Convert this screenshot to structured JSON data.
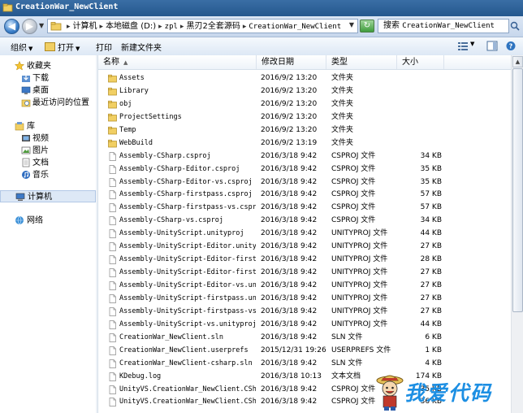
{
  "window": {
    "title": "CreationWar_NewClient"
  },
  "address": {
    "crumbs": [
      {
        "label": "计算机",
        "mono": false
      },
      {
        "label": "本地磁盘 (D:)",
        "mono": false
      },
      {
        "label": "zpl",
        "mono": true
      },
      {
        "label": "黑刃2全套源码",
        "mono": false
      },
      {
        "label": "CreationWar_NewClient",
        "mono": true
      }
    ]
  },
  "search": {
    "prefix": "搜索",
    "target": "CreationWar_NewClient"
  },
  "toolbar": {
    "organize": "组织",
    "open": "打开",
    "print": "打印",
    "new_folder": "新建文件夹"
  },
  "sidebar": {
    "favorites": "收藏夹",
    "fav_items": [
      "下载",
      "桌面",
      "最近访问的位置"
    ],
    "library": "库",
    "lib_items": [
      "视频",
      "图片",
      "文档",
      "音乐"
    ],
    "computer": "计算机",
    "network": "网络"
  },
  "columns": {
    "name": "名称",
    "date": "修改日期",
    "type": "类型",
    "size": "大小"
  },
  "files": [
    {
      "name": "Assets",
      "date": "2016/9/2 13:20",
      "type": "文件夹",
      "size": "",
      "kind": "folder"
    },
    {
      "name": "Library",
      "date": "2016/9/2 13:20",
      "type": "文件夹",
      "size": "",
      "kind": "folder"
    },
    {
      "name": "obj",
      "date": "2016/9/2 13:20",
      "type": "文件夹",
      "size": "",
      "kind": "folder"
    },
    {
      "name": "ProjectSettings",
      "date": "2016/9/2 13:20",
      "type": "文件夹",
      "size": "",
      "kind": "folder"
    },
    {
      "name": "Temp",
      "date": "2016/9/2 13:20",
      "type": "文件夹",
      "size": "",
      "kind": "folder"
    },
    {
      "name": "WebBuild",
      "date": "2016/9/2 13:19",
      "type": "文件夹",
      "size": "",
      "kind": "folder"
    },
    {
      "name": "Assembly-CSharp.csproj",
      "date": "2016/3/18 9:42",
      "type": "CSPROJ 文件",
      "size": "34 KB",
      "kind": "file"
    },
    {
      "name": "Assembly-CSharp-Editor.csproj",
      "date": "2016/3/18 9:42",
      "type": "CSPROJ 文件",
      "size": "35 KB",
      "kind": "file"
    },
    {
      "name": "Assembly-CSharp-Editor-vs.csproj",
      "date": "2016/3/18 9:42",
      "type": "CSPROJ 文件",
      "size": "35 KB",
      "kind": "file"
    },
    {
      "name": "Assembly-CSharp-firstpass.csproj",
      "date": "2016/3/18 9:42",
      "type": "CSPROJ 文件",
      "size": "57 KB",
      "kind": "file"
    },
    {
      "name": "Assembly-CSharp-firstpass-vs.csproj",
      "date": "2016/3/18 9:42",
      "type": "CSPROJ 文件",
      "size": "57 KB",
      "kind": "file"
    },
    {
      "name": "Assembly-CSharp-vs.csproj",
      "date": "2016/3/18 9:42",
      "type": "CSPROJ 文件",
      "size": "34 KB",
      "kind": "file"
    },
    {
      "name": "Assembly-UnityScript.unityproj",
      "date": "2016/3/18 9:42",
      "type": "UNITYPROJ 文件",
      "size": "44 KB",
      "kind": "file"
    },
    {
      "name": "Assembly-UnityScript-Editor.unityproj",
      "date": "2016/3/18 9:42",
      "type": "UNITYPROJ 文件",
      "size": "27 KB",
      "kind": "file"
    },
    {
      "name": "Assembly-UnityScript-Editor-firstp...",
      "date": "2016/3/18 9:42",
      "type": "UNITYPROJ 文件",
      "size": "28 KB",
      "kind": "file"
    },
    {
      "name": "Assembly-UnityScript-Editor-firstp...",
      "date": "2016/3/18 9:42",
      "type": "UNITYPROJ 文件",
      "size": "27 KB",
      "kind": "file"
    },
    {
      "name": "Assembly-UnityScript-Editor-vs.uni...",
      "date": "2016/3/18 9:42",
      "type": "UNITYPROJ 文件",
      "size": "27 KB",
      "kind": "file"
    },
    {
      "name": "Assembly-UnityScript-firstpass.uni...",
      "date": "2016/3/18 9:42",
      "type": "UNITYPROJ 文件",
      "size": "27 KB",
      "kind": "file"
    },
    {
      "name": "Assembly-UnityScript-firstpass-vs....",
      "date": "2016/3/18 9:42",
      "type": "UNITYPROJ 文件",
      "size": "27 KB",
      "kind": "file"
    },
    {
      "name": "Assembly-UnityScript-vs.unityproj",
      "date": "2016/3/18 9:42",
      "type": "UNITYPROJ 文件",
      "size": "44 KB",
      "kind": "file"
    },
    {
      "name": "CreationWar_NewClient.sln",
      "date": "2016/3/18 9:42",
      "type": "SLN 文件",
      "size": "6 KB",
      "kind": "file"
    },
    {
      "name": "CreationWar_NewClient.userprefs",
      "date": "2015/12/31 19:26",
      "type": "USERPREFS 文件",
      "size": "1 KB",
      "kind": "file"
    },
    {
      "name": "CreationWar_NewClient-csharp.sln",
      "date": "2016/3/18 9:42",
      "type": "SLN 文件",
      "size": "4 KB",
      "kind": "file"
    },
    {
      "name": "KDebug.log",
      "date": "2016/3/18 10:13",
      "type": "文本文档",
      "size": "174 KB",
      "kind": "file"
    },
    {
      "name": "UnityVS.CreationWar_NewClient.CSha...",
      "date": "2016/3/18 9:42",
      "type": "CSPROJ 文件",
      "size": "35 KB",
      "kind": "file"
    },
    {
      "name": "UnityVS.CreationWar_NewClient.CSha...",
      "date": "2016/3/18 9:42",
      "type": "CSPROJ 文件",
      "size": "36 KB",
      "kind": "file"
    }
  ],
  "watermark": "我爱代码",
  "colors": {
    "title": "#24578d",
    "folder": "#e8c14a",
    "accent": "#1d8fe3"
  }
}
